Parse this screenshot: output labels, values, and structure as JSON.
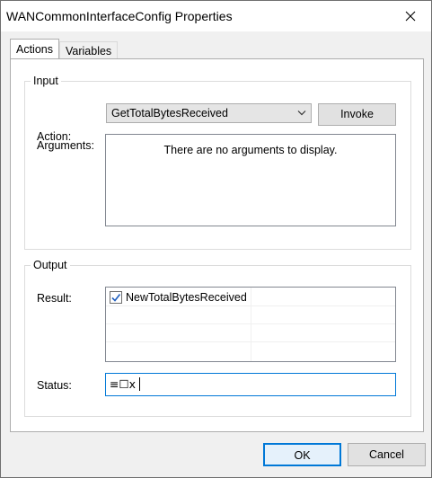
{
  "window": {
    "title": "WANCommonInterfaceConfig Properties"
  },
  "tabs": [
    {
      "label": "Actions",
      "active": true
    },
    {
      "label": "Variables",
      "active": false
    }
  ],
  "input_group": {
    "legend": "Input",
    "action_label": "Action:",
    "action_value": "GetTotalBytesReceived",
    "invoke_label": "Invoke",
    "arguments_label": "Arguments:",
    "arguments_empty_text": "There are no arguments to display."
  },
  "output_group": {
    "legend": "Output",
    "result_label": "Result:",
    "result_items": [
      "NewTotalBytesReceived"
    ],
    "status_label": "Status:",
    "status_value": "≡☐x"
  },
  "footer": {
    "ok_label": "OK",
    "cancel_label": "Cancel"
  },
  "colors": {
    "focus_border": "#0078d7",
    "check_icon": "#1f5fbf"
  }
}
